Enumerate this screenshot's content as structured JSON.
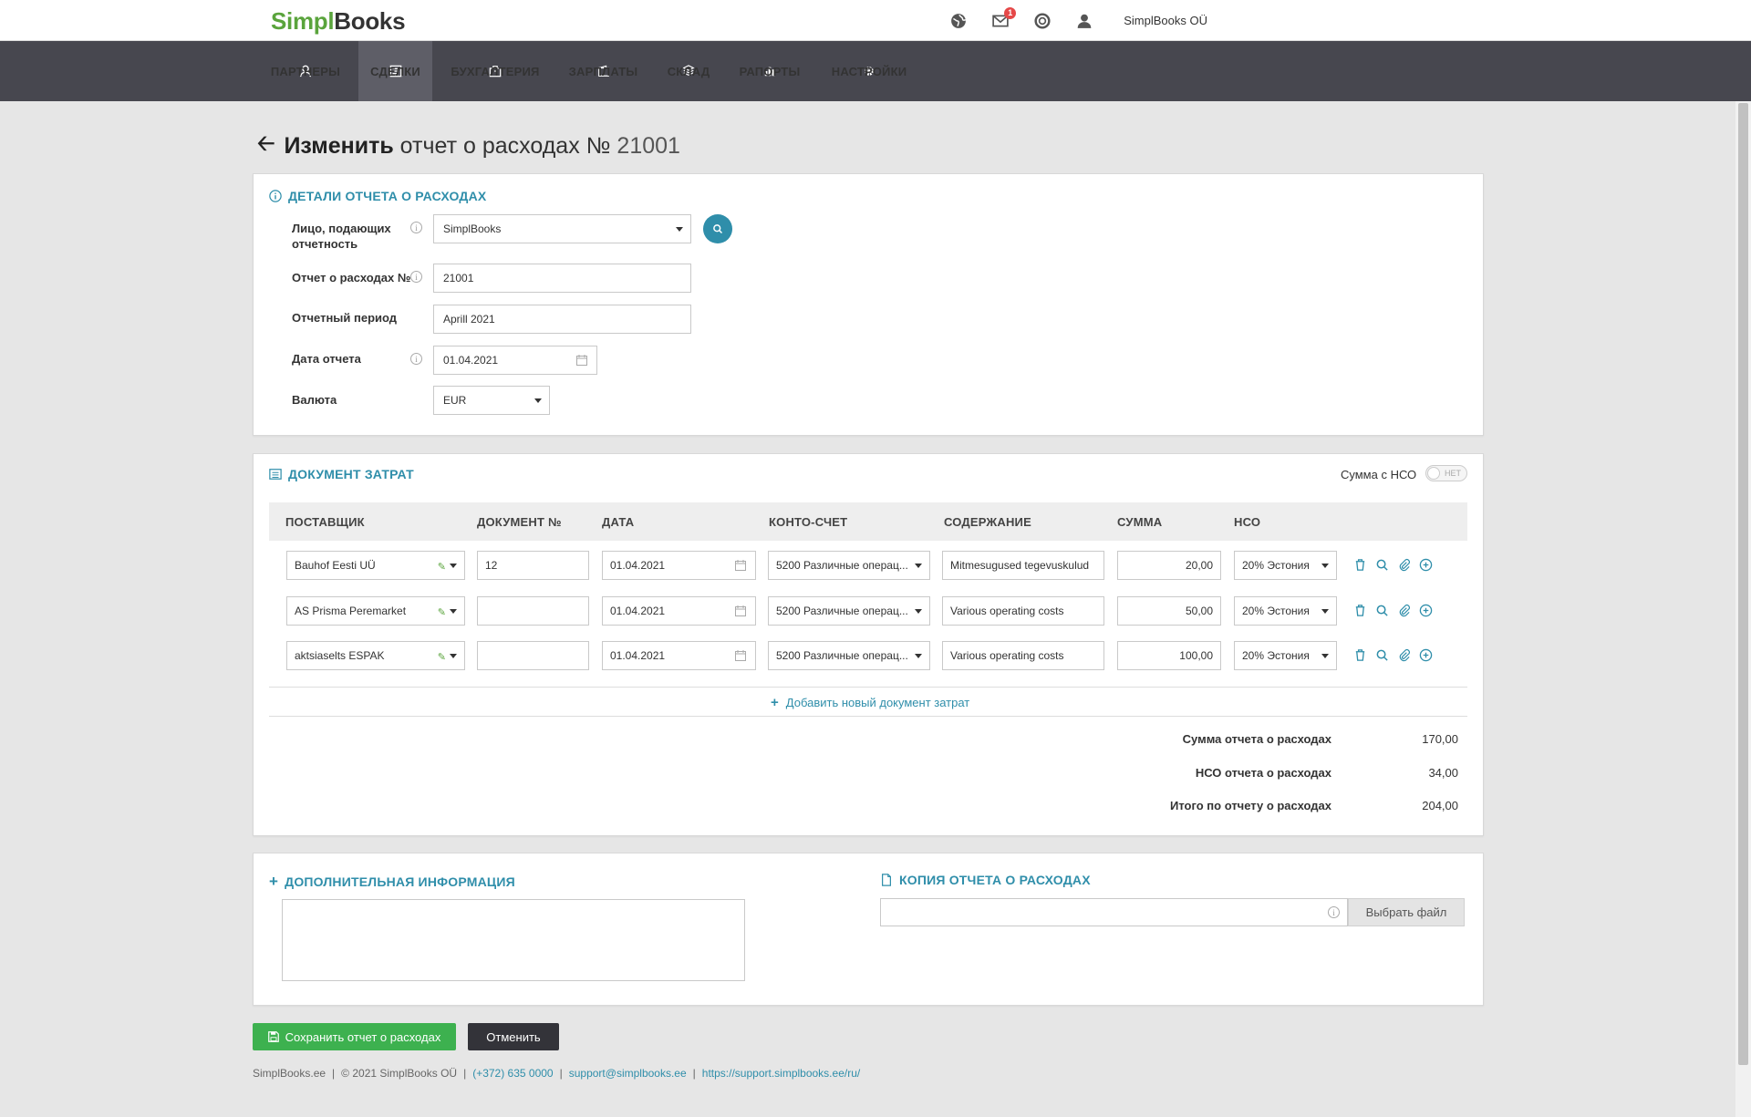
{
  "app": {
    "logo_a": "Simpl",
    "logo_b": "Books",
    "company": "SimplBooks OÜ",
    "mail_badge": "1"
  },
  "nav": [
    {
      "label": "ПАРТНЕРЫ",
      "icon": "user-icon"
    },
    {
      "label": "СДЕЛКИ",
      "icon": "deals-icon"
    },
    {
      "label": "БУХГАЛТЕРИЯ",
      "icon": "briefcase-icon"
    },
    {
      "label": "ЗАРПЛАТЫ",
      "icon": "wallet-icon"
    },
    {
      "label": "СКЛАД",
      "icon": "boxes-icon"
    },
    {
      "label": "РАПОРТЫ",
      "icon": "bar-chart-icon"
    },
    {
      "label": "НАСТРОЙКИ",
      "icon": "gear-icon"
    }
  ],
  "title": {
    "bold": "Изменить",
    "rest": "отчет о расходах №",
    "number": "21001"
  },
  "details": {
    "section": "ДЕТАЛИ ОТЧЕТА О РАСХОДАХ",
    "person_label": "Лицо, подающих отчетность",
    "person_value": "SimplBooks",
    "number_label": "Отчет о расходах №",
    "number_value": "21001",
    "period_label": "Отчетный период",
    "period_value": "Aprill 2021",
    "date_label": "Дата отчета",
    "date_value": "01.04.2021",
    "currency_label": "Валюта",
    "currency_value": "EUR"
  },
  "costs": {
    "section": "ДОКУМЕНТ ЗАТРАТ",
    "vat_toggle_label": "Сумма с НСО",
    "vat_toggle_state": "НЕТ",
    "columns": {
      "supplier": "ПОСТАВЩИК",
      "doc": "ДОКУМЕНТ №",
      "date": "ДАТА",
      "account": "КОНТО-СЧЕТ",
      "content": "СОДЕРЖАНИЕ",
      "sum": "СУММА",
      "vat": "НСО"
    },
    "rows": [
      {
        "supplier": "Bauhof Eesti UÜ",
        "doc": "12",
        "date": "01.04.2021",
        "account": "5200 Различные операц...",
        "content": "Mitmesugused tegevuskulud",
        "sum": "20,00",
        "vat": "20% Эстония"
      },
      {
        "supplier": "AS Prisma Peremarket",
        "doc": "",
        "date": "01.04.2021",
        "account": "5200 Различные операц...",
        "content": "Various operating costs",
        "sum": "50,00",
        "vat": "20% Эстония"
      },
      {
        "supplier": "aktsiaselts ESPAK",
        "doc": "",
        "date": "01.04.2021",
        "account": "5200 Различные операц...",
        "content": "Various operating costs",
        "sum": "100,00",
        "vat": "20% Эстония"
      }
    ],
    "add_label": "Добавить новый документ затрат",
    "totals": [
      {
        "label": "Сумма отчета о расходах",
        "value": "170,00"
      },
      {
        "label": "НСО отчета о расходах",
        "value": "34,00"
      },
      {
        "label": "Итого по отчету о расходах",
        "value": "204,00"
      }
    ]
  },
  "extra": {
    "info_section": "ДОПОЛНИТЕЛЬНАЯ ИНФОРМАЦИЯ",
    "copy_section": "КОПИЯ ОТЧЕТА О РАСХОДАХ",
    "choose_file": "Выбрать файл"
  },
  "buttons": {
    "save": "Сохранить отчет о расходах",
    "cancel": "Отменить"
  },
  "footer": {
    "site": "SimplBooks.ee",
    "copyright": "© 2021 SimplBooks OÜ",
    "phone": "(+372) 635 0000",
    "email": "support@simplbooks.ee",
    "support_url": "https://support.simplbooks.ee/ru/"
  },
  "colors": {
    "accent": "#2f8eaa",
    "brand_green": "#5aa43c",
    "nav_bg": "#47474f",
    "save_green": "#3db14f",
    "cancel_dark": "#333339"
  }
}
